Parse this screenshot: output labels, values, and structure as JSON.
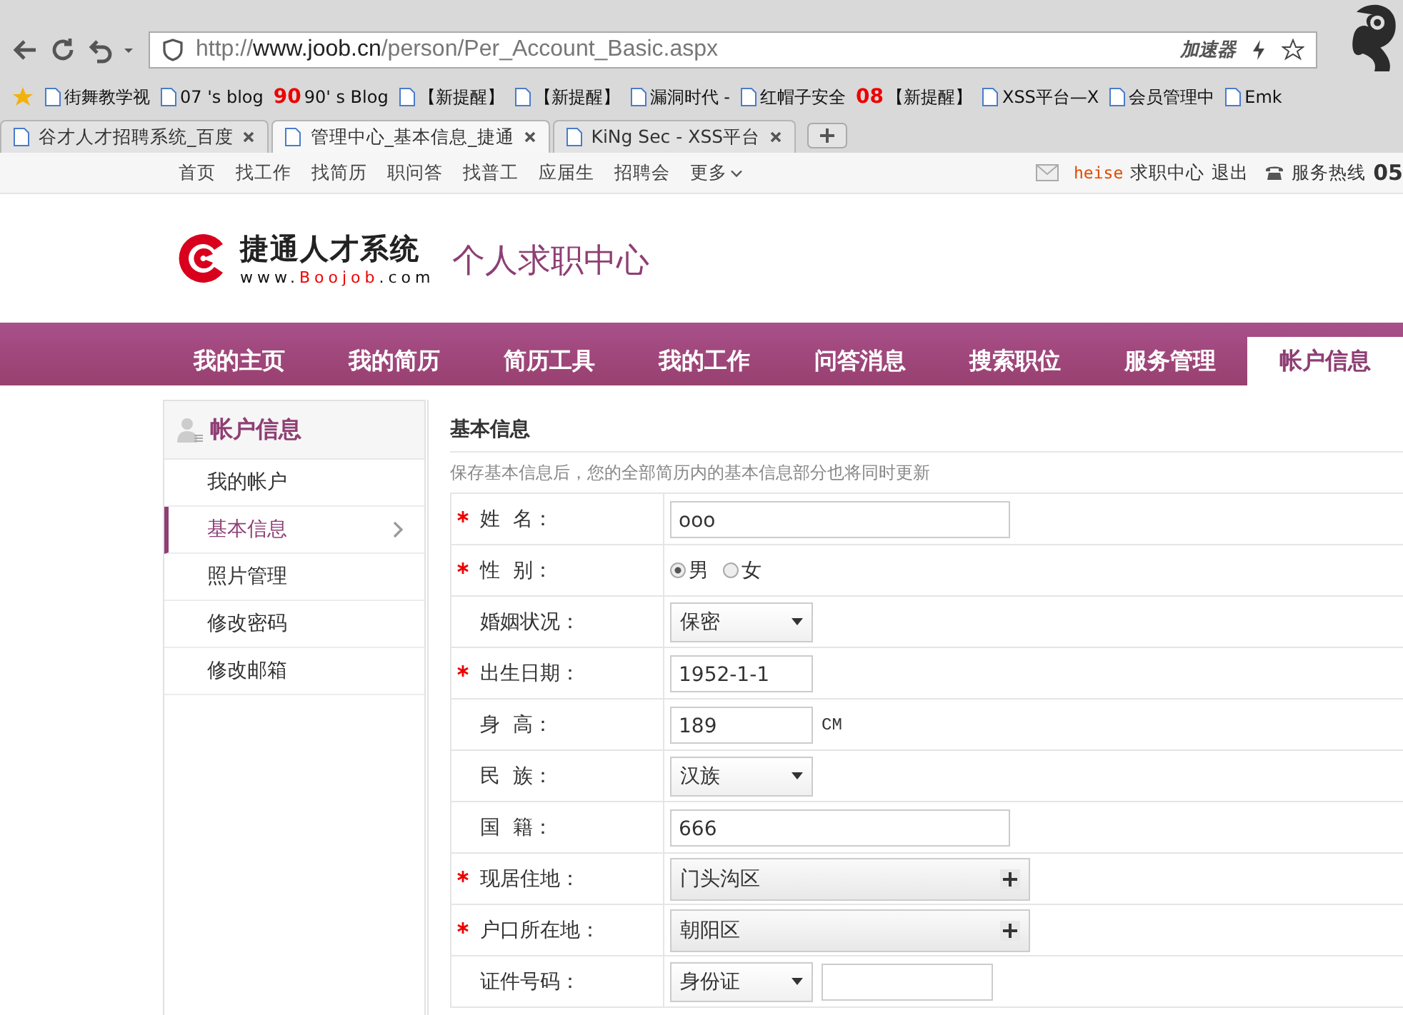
{
  "browser": {
    "address": {
      "prefix": "http://",
      "host": "www.joob.cn",
      "path": "/person/Per_Account_Basic.aspx"
    },
    "accelerator": "加速器",
    "bookmarks": [
      {
        "label": "街舞教学视"
      },
      {
        "label": "07 's blog"
      },
      {
        "label": "90' s Blog",
        "icon_text": "90"
      },
      {
        "label": "【新提醒】"
      },
      {
        "label": "【新提醒】"
      },
      {
        "label": "漏洞时代 -"
      },
      {
        "label": "红帽子安全"
      },
      {
        "label": "【新提醒】",
        "icon_text": "08"
      },
      {
        "label": "XSS平台—X"
      },
      {
        "label": "会员管理中"
      },
      {
        "label": "Emk"
      }
    ],
    "tabs": [
      {
        "label": "谷才人才招聘系统_百度",
        "selected": false
      },
      {
        "label": "管理中心_基本信息_捷通",
        "selected": true
      },
      {
        "label": "KiNg Sec - XSS平台",
        "selected": false
      }
    ]
  },
  "top_nav": {
    "links": [
      "首页",
      "找工作",
      "找简历",
      "职问答",
      "找普工",
      "应届生",
      "招聘会",
      "更多"
    ],
    "user": "heise",
    "user_links": [
      "求职中心",
      "退出"
    ],
    "hotline": "服务热线",
    "hotline_number": "05"
  },
  "header": {
    "logo_name": "捷通人才系统",
    "logo_url_prefix": "www.",
    "logo_url_brand": "Boojob",
    "logo_url_suffix": ".com",
    "title": "个人求职中心"
  },
  "main_nav": [
    {
      "label": "我的主页",
      "selected": false
    },
    {
      "label": "我的简历",
      "selected": false
    },
    {
      "label": "简历工具",
      "selected": false
    },
    {
      "label": "我的工作",
      "selected": false
    },
    {
      "label": "问答消息",
      "selected": false
    },
    {
      "label": "搜索职位",
      "selected": false
    },
    {
      "label": "服务管理",
      "selected": false
    },
    {
      "label": "帐户信息",
      "selected": true
    }
  ],
  "sidebar": {
    "title": "帐户信息",
    "items": [
      {
        "label": "我的帐户",
        "selected": false
      },
      {
        "label": "基本信息",
        "selected": true
      },
      {
        "label": "照片管理",
        "selected": false
      },
      {
        "label": "修改密码",
        "selected": false
      },
      {
        "label": "修改邮箱",
        "selected": false
      }
    ]
  },
  "form": {
    "title": "基本信息",
    "note": "保存基本信息后，您的全部简历内的基本信息部分也将同时更新",
    "rows": [
      {
        "label": "姓  名：",
        "required": true,
        "kind": "text",
        "value": "ooo"
      },
      {
        "label": "性  别：",
        "required": true,
        "kind": "radio",
        "options": [
          {
            "label": "男",
            "selected": true
          },
          {
            "label": "女",
            "selected": false
          }
        ]
      },
      {
        "label": "婚姻状况：",
        "required": false,
        "kind": "select",
        "value": "保密"
      },
      {
        "label": "出生日期：",
        "required": true,
        "kind": "short",
        "value": "1952-1-1"
      },
      {
        "label": "身  高：",
        "required": false,
        "kind": "short",
        "value": "189",
        "unit": "CM"
      },
      {
        "label": "民  族：",
        "required": false,
        "kind": "select",
        "value": "汉族"
      },
      {
        "label": "国  籍：",
        "required": false,
        "kind": "text",
        "value": "666"
      },
      {
        "label": "现居住地：",
        "required": true,
        "kind": "region",
        "value": "门头沟区"
      },
      {
        "label": "户口所在地：",
        "required": true,
        "kind": "region",
        "value": "朝阳区"
      },
      {
        "label": "证件号码：",
        "required": false,
        "kind": "id",
        "value": "身份证"
      }
    ]
  }
}
